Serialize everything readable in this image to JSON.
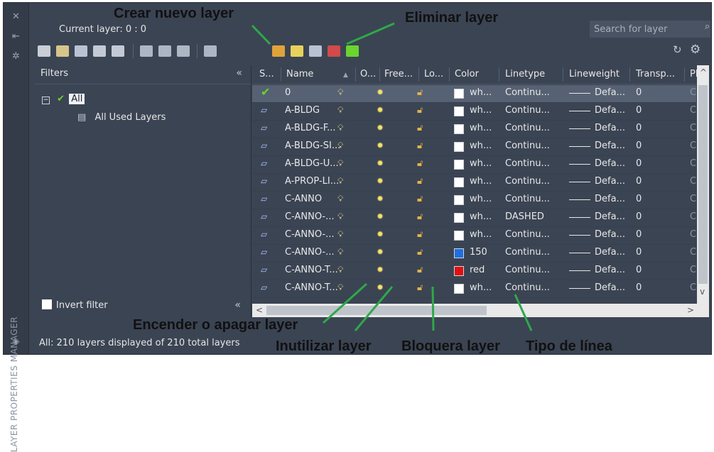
{
  "palette": {
    "panel": "#3b4453",
    "strip": "#343c49",
    "selected_row": "#566173",
    "annotation_line": "#2fa84a",
    "current_check": "#6bd42e"
  },
  "sidebar": {
    "title": "LAYER PROPERTIES MANAGER",
    "icons": [
      "close-icon",
      "auto-hide-icon",
      "properties-icon",
      "layer-stack-icon"
    ]
  },
  "header": {
    "current_layer": "Current layer: 0 : 0",
    "search_placeholder": "Search for layer"
  },
  "toolbar": {
    "left_icons": [
      "new-property-filter-icon",
      "new-group-filter-icon",
      "layer-states-manager-icon",
      "layer-isolate-icon",
      "layer-walk-icon",
      "layer-freeze-icon",
      "layer-off-icon",
      "layer-lock-icon",
      "layer-merge-icon"
    ],
    "layer_icons": [
      "new-layer-icon",
      "new-layer-frozen-vp-icon",
      "delete-layer-icon",
      "delete-layer-alt-icon",
      "set-current-icon"
    ]
  },
  "filters": {
    "title": "Filters",
    "collapse": "«",
    "tree": [
      {
        "label": "All",
        "children": [
          "All Used Layers"
        ]
      }
    ],
    "invert_label": "Invert filter",
    "invert_collapse": "«"
  },
  "grid": {
    "columns": [
      "S...",
      "Name",
      "O...",
      "Free...",
      "Lo...",
      "Color",
      "Linetype",
      "Lineweight",
      "Transp...",
      "Pl"
    ],
    "sort_glyph": "▲",
    "rows": [
      {
        "name": "0",
        "color_name": "wh...",
        "color_hex": "#ffffff",
        "linetype": "Continu...",
        "lineweight": "Defa...",
        "transparency": "0",
        "plot": "Co",
        "current": true
      },
      {
        "name": "A-BLDG",
        "color_name": "wh...",
        "color_hex": "#ffffff",
        "linetype": "Continu...",
        "lineweight": "Defa...",
        "transparency": "0",
        "plot": "Co",
        "current": false
      },
      {
        "name": "A-BLDG-F...",
        "color_name": "wh...",
        "color_hex": "#ffffff",
        "linetype": "Continu...",
        "lineweight": "Defa...",
        "transparency": "0",
        "plot": "Co",
        "current": false
      },
      {
        "name": "A-BLDG-SI...",
        "color_name": "wh...",
        "color_hex": "#ffffff",
        "linetype": "Continu...",
        "lineweight": "Defa...",
        "transparency": "0",
        "plot": "Co",
        "current": false
      },
      {
        "name": "A-BLDG-U...",
        "color_name": "wh...",
        "color_hex": "#ffffff",
        "linetype": "Continu...",
        "lineweight": "Defa...",
        "transparency": "0",
        "plot": "Co",
        "current": false
      },
      {
        "name": "A-PROP-LI...",
        "color_name": "wh...",
        "color_hex": "#ffffff",
        "linetype": "Continu...",
        "lineweight": "Defa...",
        "transparency": "0",
        "plot": "Co",
        "current": false
      },
      {
        "name": "C-ANNO",
        "color_name": "wh...",
        "color_hex": "#ffffff",
        "linetype": "Continu...",
        "lineweight": "Defa...",
        "transparency": "0",
        "plot": "Co",
        "current": false
      },
      {
        "name": "C-ANNO-...",
        "color_name": "wh...",
        "color_hex": "#ffffff",
        "linetype": "DASHED",
        "lineweight": "Defa...",
        "transparency": "0",
        "plot": "Co",
        "current": false
      },
      {
        "name": "C-ANNO-...",
        "color_name": "wh...",
        "color_hex": "#ffffff",
        "linetype": "Continu...",
        "lineweight": "Defa...",
        "transparency": "0",
        "plot": "Co",
        "current": false
      },
      {
        "name": "C-ANNO-...",
        "color_name": "150",
        "color_hex": "#1e6fe0",
        "linetype": "Continu...",
        "lineweight": "Defa...",
        "transparency": "0",
        "plot": "Co",
        "current": false
      },
      {
        "name": "C-ANNO-T...",
        "color_name": "red",
        "color_hex": "#e01010",
        "linetype": "Continu...",
        "lineweight": "Defa...",
        "transparency": "0",
        "plot": "Co",
        "current": false
      },
      {
        "name": "C-ANNO-T...",
        "color_name": "wh...",
        "color_hex": "#ffffff",
        "linetype": "Continu...",
        "lineweight": "Defa...",
        "transparency": "0",
        "plot": "Co",
        "current": false
      }
    ]
  },
  "status": "All: 210 layers displayed of 210 total layers",
  "annotations": {
    "new_layer": "Crear nuevo layer",
    "delete_layer": "Eliminar layer",
    "on_off": "Encender o apagar layer",
    "freeze": "Inutilizar layer",
    "lock": "Bloquera layer",
    "linetype": "Tipo de línea"
  }
}
